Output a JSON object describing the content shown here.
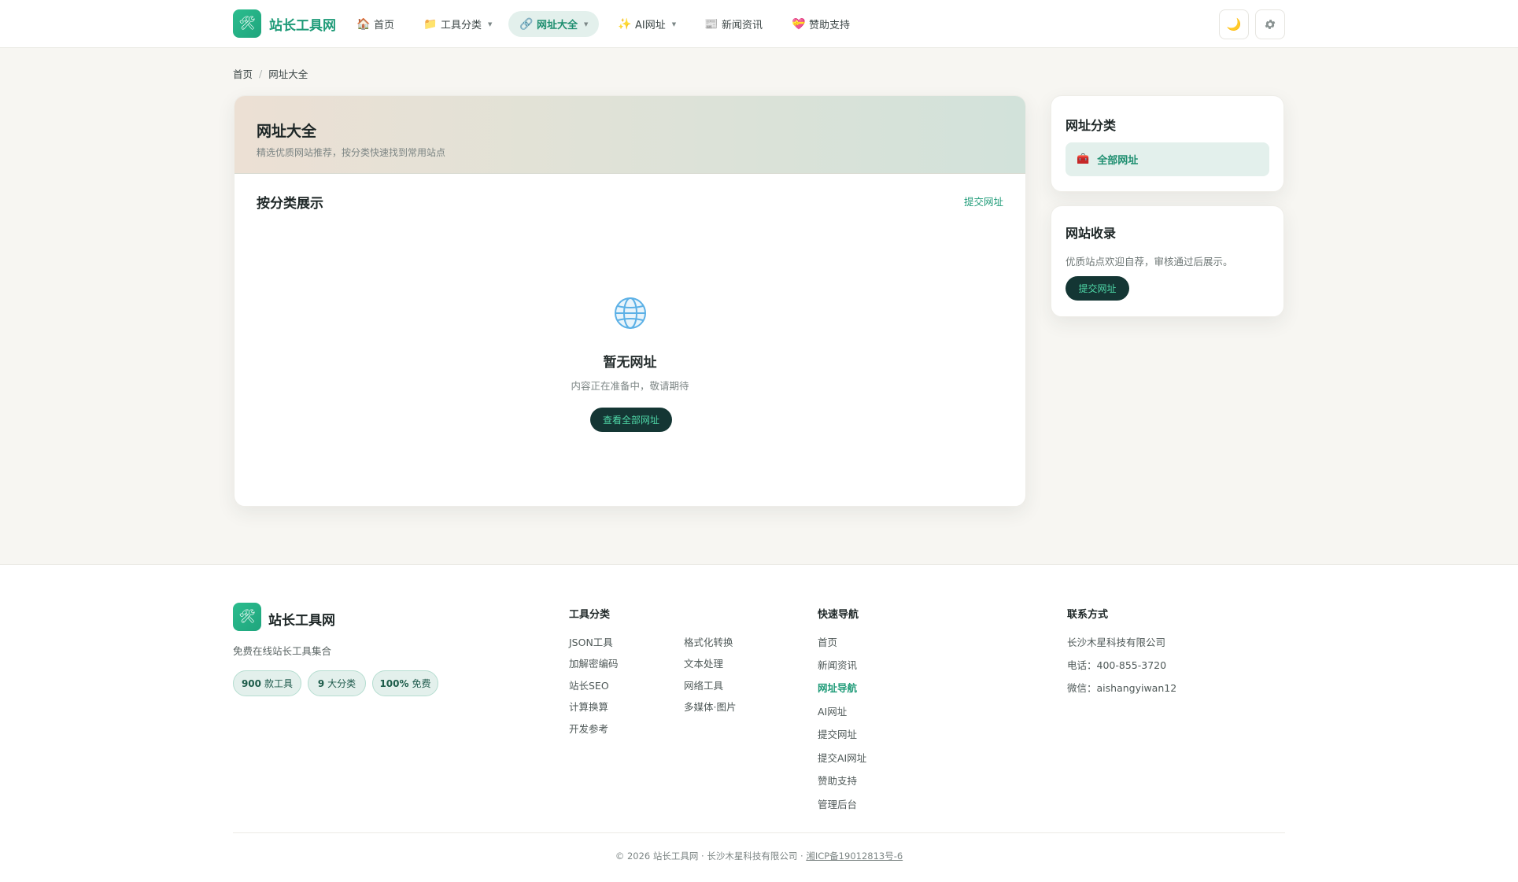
{
  "header": {
    "logo_text": "站长工具网",
    "nav": [
      {
        "icon": "house-icon",
        "glyph": "🏠",
        "label": "首页",
        "caret": false,
        "active": false
      },
      {
        "icon": "folder-icon",
        "glyph": "📁",
        "label": "工具分类",
        "caret": true,
        "active": false
      },
      {
        "icon": "link-icon",
        "glyph": "🔗",
        "label": "网址大全",
        "caret": true,
        "active": true
      },
      {
        "icon": "sparkles-icon",
        "glyph": "✨",
        "label": "AI网址",
        "caret": true,
        "active": false
      },
      {
        "icon": "newspaper-icon",
        "glyph": "📰",
        "label": "新闻资讯",
        "caret": false,
        "active": false
      },
      {
        "icon": "heart-icon",
        "glyph": "💝",
        "label": "赞助支持",
        "caret": false,
        "active": false
      }
    ],
    "theme_icon": "moon-icon",
    "settings_icon": "gear-icon"
  },
  "breadcrumb": {
    "home": "首页",
    "separator": "/",
    "current": "网址大全"
  },
  "main": {
    "hero_title": "网址大全",
    "hero_subtitle": "精选优质网站推荐，按分类快速找到常用站点",
    "section_title": "按分类展示",
    "submit_link": "提交网址",
    "empty_icon": "globe-icon",
    "empty_title": "暂无网址",
    "empty_subtitle": "内容正在准备中，敬请期待",
    "empty_button": "查看全部网址"
  },
  "sidebar": {
    "categories_title": "网址分类",
    "category_item": {
      "icon": "toolbox-icon",
      "label": "全部网址"
    },
    "submit_title": "网站收录",
    "submit_text": "优质站点欢迎自荐，审核通过后展示。",
    "submit_button": "提交网址"
  },
  "footer": {
    "brand": "站长工具网",
    "description": "免费在线站长工具集合",
    "pills": [
      {
        "num": "900",
        "text": "款工具"
      },
      {
        "num": "9",
        "text": "大分类"
      },
      {
        "num": "100%",
        "text": "免费"
      }
    ],
    "tools_title": "工具分类",
    "tools_col1": [
      "JSON工具",
      "加解密编码",
      "站长SEO",
      "计算换算",
      "开发参考"
    ],
    "tools_col2": [
      "格式化转换",
      "文本处理",
      "网络工具",
      "多媒体·图片"
    ],
    "nav_title": "快速导航",
    "nav_links": [
      "首页",
      "新闻资讯",
      "网址导航",
      "AI网址",
      "提交网址",
      "提交AI网址",
      "赞助支持",
      "管理后台"
    ],
    "nav_active_index": 2,
    "contact_title": "联系方式",
    "contact_lines": [
      "长沙木星科技有限公司",
      "电话：400-855-3720",
      "微信：aishangyiwan12"
    ],
    "copyright": "© 2026 站长工具网 · 长沙木星科技有限公司 · ",
    "icp": "湘ICP备19012813号-6"
  },
  "colors": {
    "accent": "#1f9b78",
    "dark_button": "#143634",
    "button_text": "#4fd8a8"
  }
}
